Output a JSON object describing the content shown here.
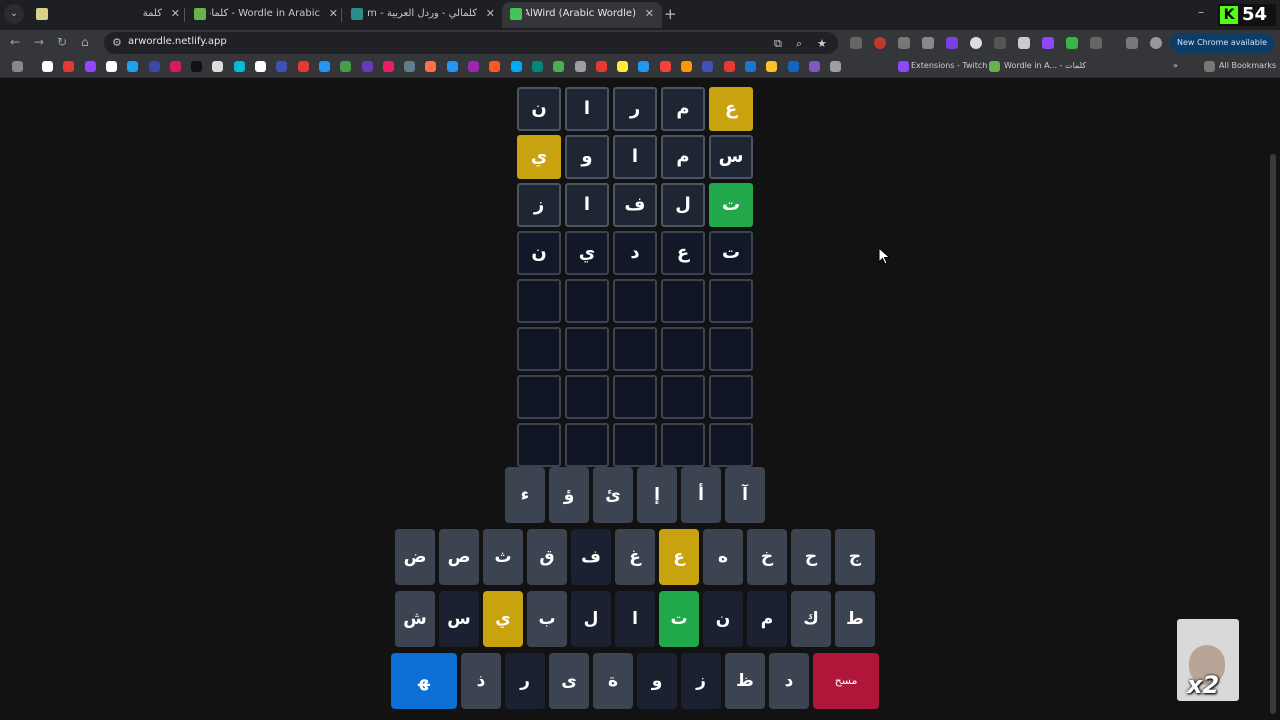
{
  "browser": {
    "tabs": [
      {
        "title": "كلمة",
        "fav_color": "#d9d08a",
        "active": false
      },
      {
        "title": "Wordle in Arabic - كلمات",
        "fav_color": "#6ab04c",
        "active": false
      },
      {
        "title": "كلمالي - وردل العربية - naly.com",
        "fav_color": "#2e8b8b",
        "active": false
      },
      {
        "title": "AlWird (Arabic Wordle) - الورد",
        "fav_color": "#45c45a",
        "active": true
      }
    ],
    "tab_close": "✕",
    "new_tab": "+",
    "url": "arwordle.netlify.app",
    "update_button": "New Chrome available",
    "bookmarks": {
      "extensions_twitch": "Extensions - Twitch",
      "wordle_arabic": "Wordle in A... - كلمات",
      "all_bookmarks": "All Bookmarks"
    },
    "counter": {
      "letter": "K",
      "value": "54"
    }
  },
  "board": {
    "rows": [
      [
        {
          "l": "ن",
          "s": "absent"
        },
        {
          "l": "ا",
          "s": "absent"
        },
        {
          "l": "ر",
          "s": "absent"
        },
        {
          "l": "م",
          "s": "absent"
        },
        {
          "l": "ع",
          "s": "present"
        }
      ],
      [
        {
          "l": "ي",
          "s": "present"
        },
        {
          "l": "و",
          "s": "absent"
        },
        {
          "l": "ا",
          "s": "absent"
        },
        {
          "l": "م",
          "s": "absent"
        },
        {
          "l": "س",
          "s": "absent"
        }
      ],
      [
        {
          "l": "ز",
          "s": "absent"
        },
        {
          "l": "ا",
          "s": "absent"
        },
        {
          "l": "ف",
          "s": "absent"
        },
        {
          "l": "ل",
          "s": "absent"
        },
        {
          "l": "ت",
          "s": "correct"
        }
      ],
      [
        {
          "l": "ن",
          "s": "filled"
        },
        {
          "l": "ي",
          "s": "filled"
        },
        {
          "l": "د",
          "s": "filled"
        },
        {
          "l": "ع",
          "s": "filled"
        },
        {
          "l": "ت",
          "s": "filled"
        }
      ],
      [
        {
          "l": "",
          "s": "empty"
        },
        {
          "l": "",
          "s": "empty"
        },
        {
          "l": "",
          "s": "empty"
        },
        {
          "l": "",
          "s": "empty"
        },
        {
          "l": "",
          "s": "empty"
        }
      ],
      [
        {
          "l": "",
          "s": "empty"
        },
        {
          "l": "",
          "s": "empty"
        },
        {
          "l": "",
          "s": "empty"
        },
        {
          "l": "",
          "s": "empty"
        },
        {
          "l": "",
          "s": "empty"
        }
      ],
      [
        {
          "l": "",
          "s": "empty"
        },
        {
          "l": "",
          "s": "empty"
        },
        {
          "l": "",
          "s": "empty"
        },
        {
          "l": "",
          "s": "empty"
        },
        {
          "l": "",
          "s": "empty"
        }
      ],
      [
        {
          "l": "",
          "s": "empty"
        },
        {
          "l": "",
          "s": "empty"
        },
        {
          "l": "",
          "s": "empty"
        },
        {
          "l": "",
          "s": "empty"
        },
        {
          "l": "",
          "s": "empty"
        }
      ]
    ]
  },
  "keyboard": {
    "rows": [
      [
        {
          "k": "ء",
          "s": "unused"
        },
        {
          "k": "ؤ",
          "s": "unused"
        },
        {
          "k": "ئ",
          "s": "unused"
        },
        {
          "k": "إ",
          "s": "unused"
        },
        {
          "k": "أ",
          "s": "unused"
        },
        {
          "k": "آ",
          "s": "unused"
        }
      ],
      [
        {
          "k": "ض",
          "s": "unused"
        },
        {
          "k": "ص",
          "s": "unused"
        },
        {
          "k": "ث",
          "s": "unused"
        },
        {
          "k": "ق",
          "s": "unused"
        },
        {
          "k": "ف",
          "s": "absent"
        },
        {
          "k": "غ",
          "s": "unused"
        },
        {
          "k": "ع",
          "s": "present"
        },
        {
          "k": "ه",
          "s": "unused"
        },
        {
          "k": "خ",
          "s": "unused"
        },
        {
          "k": "ح",
          "s": "unused"
        },
        {
          "k": "ج",
          "s": "unused"
        }
      ],
      [
        {
          "k": "ش",
          "s": "unused"
        },
        {
          "k": "س",
          "s": "absent"
        },
        {
          "k": "ي",
          "s": "present"
        },
        {
          "k": "ب",
          "s": "unused"
        },
        {
          "k": "ل",
          "s": "absent"
        },
        {
          "k": "ا",
          "s": "absent"
        },
        {
          "k": "ت",
          "s": "correct"
        },
        {
          "k": "ن",
          "s": "absent"
        },
        {
          "k": "م",
          "s": "absent"
        },
        {
          "k": "ك",
          "s": "unused"
        },
        {
          "k": "ط",
          "s": "unused"
        }
      ],
      [
        {
          "k": "ﻬ",
          "s": "enter"
        },
        {
          "k": "ذ",
          "s": "unused"
        },
        {
          "k": "ر",
          "s": "absent"
        },
        {
          "k": "ى",
          "s": "unused"
        },
        {
          "k": "ة",
          "s": "unused"
        },
        {
          "k": "و",
          "s": "absent"
        },
        {
          "k": "ز",
          "s": "absent"
        },
        {
          "k": "ظ",
          "s": "unused"
        },
        {
          "k": "د",
          "s": "unused"
        },
        {
          "k": "مسح",
          "s": "delete"
        }
      ]
    ]
  },
  "webcam": {
    "multiplier": "x2"
  }
}
